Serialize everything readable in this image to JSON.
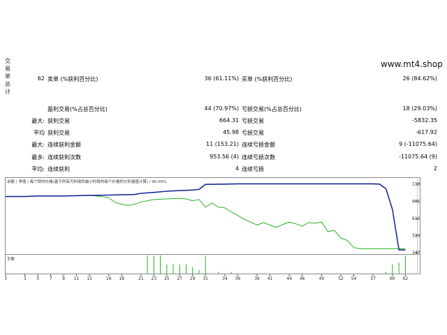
{
  "side_title": [
    "交",
    "易",
    "单",
    "总",
    "计"
  ],
  "watermark": "www.mt4.shop",
  "stats": {
    "total_trades": "62",
    "short_label": "卖单 (%获利百分比)",
    "short_value": "36 (61.11%)",
    "long_label": "买单 (%获利百分比)",
    "long_value": "26 (84.62%)",
    "profit_trades_label": "盈利交易(%占总百分比)",
    "profit_trades_value": "44 (70.97%)",
    "loss_trades_label": "亏损交易(%占总百分比)",
    "loss_trades_value": "18 (29.03%)",
    "largest_prefix": "最大:",
    "largest_profit_label": "获利交易",
    "largest_profit_value": "664.31",
    "largest_loss_label": "亏损交易",
    "largest_loss_value": "-5832.35",
    "average_prefix": "平均",
    "avg_profit_label": "获利交易",
    "avg_profit_value": "45.98",
    "avg_loss_label": "亏损交易",
    "avg_loss_value": "-617.92",
    "max_prefix": "最大:",
    "max_consec_wins_label": "连续获利金额",
    "max_consec_wins_value": "11 (153.21)",
    "max_consec_losses_label": "连续亏损金额",
    "max_consec_losses_value": "9 (-11075.64)",
    "maximal_prefix": "最多:",
    "maximal_consec_profit_label": "连续获利次数",
    "maximal_consec_profit_value": "953.56 (4)",
    "maximal_consec_loss_label": "连续亏损次数",
    "maximal_consec_loss_value": "-11075.64 (9)",
    "avg2_prefix": "平均:",
    "avg_consec_wins_label": "连续获利",
    "avg_consec_wins_value": "4",
    "avg_consec_losses_label": "连续亏损",
    "avg_consec_losses_value": "2"
  },
  "chart_data": {
    "type": "line",
    "legend_text": "余额 / 净值 / 每个即时价格(基于所有可利用的最小时段的每个价格的分形插值计算) / 90.00%",
    "legend_balance": "余额",
    "legend_equity": "净值",
    "volume_label": "手数",
    "y_ticks": [
      "11910",
      "9019",
      "6128",
      "3238",
      "347"
    ],
    "y_tick_values": [
      11910,
      9019,
      6128,
      3238,
      347
    ],
    "x_ticks": [
      "0",
      "3",
      "5",
      "7",
      "9",
      "11",
      "13",
      "16",
      "18",
      "21",
      "23",
      "25",
      "27",
      "29",
      "31",
      "34",
      "36",
      "39",
      "41",
      "44",
      "46",
      "49",
      "52",
      "54",
      "57",
      "60",
      "62"
    ],
    "ylim": [
      347,
      12700
    ],
    "xlim": [
      0,
      62.5
    ],
    "colors": {
      "balance": "#1a2a9c",
      "equity": "#22b022",
      "volume": "#22b022"
    },
    "series": [
      {
        "name": "余额",
        "x": [
          0,
          3,
          5,
          9,
          13,
          16,
          18,
          20,
          21,
          23,
          25,
          27,
          29,
          30,
          31,
          34,
          36,
          40,
          44,
          48,
          52,
          54,
          56,
          57,
          58,
          59,
          60,
          61,
          62
        ],
        "y": [
          9800,
          9800,
          9900,
          9900,
          10000,
          10050,
          10100,
          10150,
          10350,
          10500,
          10700,
          10800,
          10900,
          11000,
          11850,
          11900,
          11950,
          11950,
          11950,
          11950,
          11950,
          11950,
          11950,
          11950,
          11900,
          11100,
          7600,
          800,
          800
        ]
      },
      {
        "name": "净值",
        "x": [
          0,
          3,
          5,
          9,
          13,
          15,
          16,
          17,
          18,
          19,
          20,
          21,
          23,
          25,
          27,
          28,
          29,
          30,
          31,
          32,
          33,
          34,
          35,
          36,
          37,
          38,
          39,
          40,
          41,
          42,
          43,
          44,
          45,
          46,
          47,
          48,
          49,
          50,
          51,
          52,
          53,
          54,
          55,
          56,
          57,
          58,
          59,
          60,
          61,
          62
        ],
        "y": [
          9800,
          9800,
          9900,
          9900,
          10000,
          9800,
          9600,
          8800,
          8500,
          8300,
          8500,
          8900,
          9300,
          9400,
          9500,
          9400,
          9100,
          9300,
          8000,
          8700,
          8000,
          7900,
          7200,
          6600,
          6000,
          5500,
          5000,
          5400,
          5000,
          4600,
          5100,
          5500,
          5200,
          4800,
          5400,
          5300,
          5500,
          3900,
          4100,
          2800,
          2400,
          1200,
          1000,
          1000,
          1000,
          1000,
          1000,
          1000,
          1000,
          1000
        ]
      }
    ],
    "volume": {
      "x": [
        22,
        23,
        24,
        25,
        26,
        27,
        28,
        29,
        30,
        31,
        33,
        35,
        59,
        60,
        61,
        62
      ],
      "values": [
        1.0,
        1.0,
        1.0,
        0.5,
        0.5,
        0.5,
        0.5,
        0.35,
        0.2,
        1.0,
        0.1,
        0.1,
        0.1,
        0.5,
        0.6,
        1.0
      ]
    }
  }
}
